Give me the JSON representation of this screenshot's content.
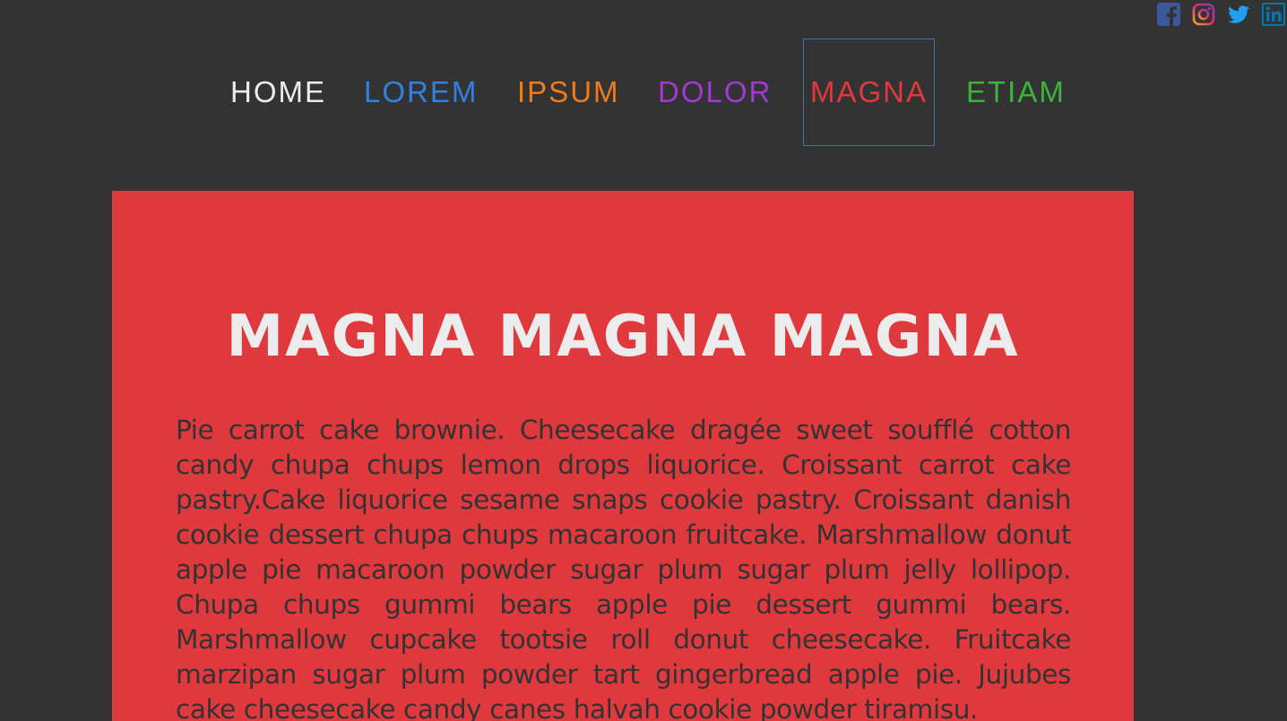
{
  "social": [
    {
      "name": "facebook-icon",
      "color": "#3b5998"
    },
    {
      "name": "instagram-icon",
      "color": "#c13584"
    },
    {
      "name": "twitter-icon",
      "color": "#1da1f2"
    },
    {
      "name": "linkedin-icon",
      "color": "#0077b5"
    }
  ],
  "nav": {
    "items": [
      {
        "label": "HOME",
        "color": "#ececec"
      },
      {
        "label": "LOREM",
        "color": "#2f82e0"
      },
      {
        "label": "IPSUM",
        "color": "#f07b1d"
      },
      {
        "label": "DOLOR",
        "color": "#a03ad0"
      },
      {
        "label": "MAGNA",
        "color": "#e0393d",
        "active": true
      },
      {
        "label": "ETIAM",
        "color": "#3cb33c"
      }
    ]
  },
  "main": {
    "background": "#e0393d",
    "title": "MAGNA MAGNA MAGNA",
    "body": "Pie carrot cake brownie. Cheesecake dragée sweet soufflé cotton candy chupa chups lemon drops liquorice. Croissant carrot cake pastry.Cake liquorice sesame snaps cookie pastry. Croissant danish cookie dessert chupa chups macaroon fruitcake. Marshmallow donut apple pie macaroon powder sugar plum sugar plum jelly lollipop. Chupa chups gummi bears apple pie dessert gummi bears. Marshmallow cupcake tootsie roll donut cheesecake. Fruitcake marzipan sugar plum powder tart gingerbread apple pie. Jujubes cake cheesecake candy canes halvah cookie powder tiramisu."
  }
}
